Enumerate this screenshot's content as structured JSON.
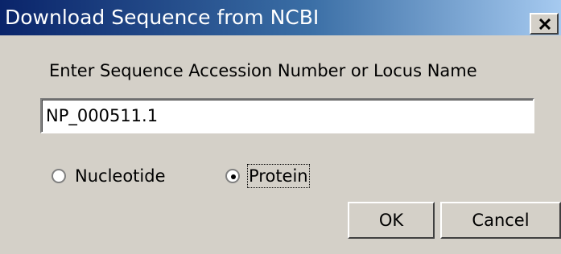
{
  "window": {
    "title": "Download Sequence from NCBI",
    "close_icon": "close-icon"
  },
  "form": {
    "prompt": "Enter Sequence Accession Number or Locus Name",
    "accession_value": "NP_000511.1"
  },
  "sequence_type": {
    "options": [
      {
        "label": "Nucleotide",
        "selected": false
      },
      {
        "label": "Protein",
        "selected": true
      }
    ]
  },
  "buttons": {
    "ok_label": "OK",
    "cancel_label": "Cancel"
  },
  "colors": {
    "titlebar_start": "#0a246a",
    "titlebar_end": "#a6caf0",
    "dialog_background": "#d4d0c8"
  }
}
